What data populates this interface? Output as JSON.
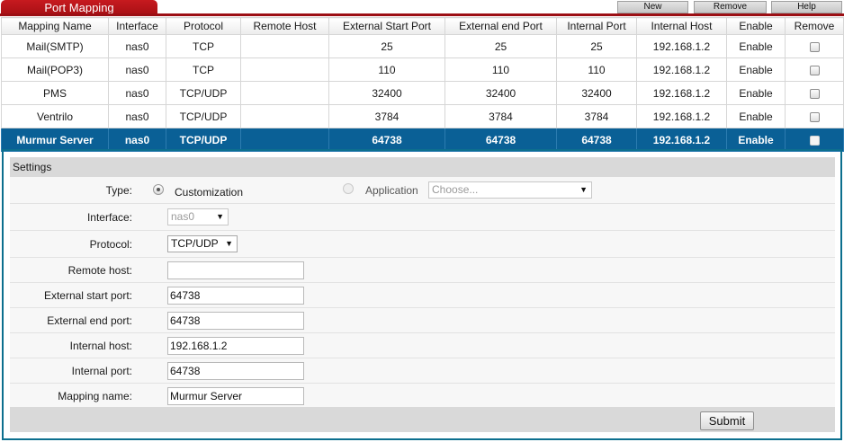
{
  "header": {
    "title": "Port Mapping",
    "buttons": {
      "new": "New",
      "remove": "Remove",
      "help": "Help"
    }
  },
  "table": {
    "columns": [
      "Mapping Name",
      "Interface",
      "Protocol",
      "Remote Host",
      "External Start Port",
      "External end Port",
      "Internal Port",
      "Internal Host",
      "Enable",
      "Remove"
    ],
    "rows": [
      {
        "name": "Mail(SMTP)",
        "interface": "nas0",
        "protocol": "TCP",
        "remote_host": "",
        "ext_start": "25",
        "ext_end": "25",
        "int_port": "25",
        "int_host": "192.168.1.2",
        "enable": "Enable",
        "remove_checked": false
      },
      {
        "name": "Mail(POP3)",
        "interface": "nas0",
        "protocol": "TCP",
        "remote_host": "",
        "ext_start": "110",
        "ext_end": "110",
        "int_port": "110",
        "int_host": "192.168.1.2",
        "enable": "Enable",
        "remove_checked": false
      },
      {
        "name": "PMS",
        "interface": "nas0",
        "protocol": "TCP/UDP",
        "remote_host": "",
        "ext_start": "32400",
        "ext_end": "32400",
        "int_port": "32400",
        "int_host": "192.168.1.2",
        "enable": "Enable",
        "remove_checked": false
      },
      {
        "name": "Ventrilo",
        "interface": "nas0",
        "protocol": "TCP/UDP",
        "remote_host": "",
        "ext_start": "3784",
        "ext_end": "3784",
        "int_port": "3784",
        "int_host": "192.168.1.2",
        "enable": "Enable",
        "remove_checked": false
      },
      {
        "name": "Murmur Server",
        "interface": "nas0",
        "protocol": "TCP/UDP",
        "remote_host": "",
        "ext_start": "64738",
        "ext_end": "64738",
        "int_port": "64738",
        "int_host": "192.168.1.2",
        "enable": "Enable",
        "remove_checked": false
      }
    ],
    "selected_row": 4
  },
  "settings": {
    "title": "Settings",
    "type_label": "Type:",
    "type_options": {
      "customization": "Customization",
      "application": "Application"
    },
    "type_selected": "customization",
    "application_select": "Choose...",
    "interface_label": "Interface:",
    "interface_value": "nas0",
    "protocol_label": "Protocol:",
    "protocol_value": "TCP/UDP",
    "remote_host_label": "Remote host:",
    "remote_host_value": "",
    "ext_start_label": "External start port:",
    "ext_start_value": "64738",
    "ext_end_label": "External end port:",
    "ext_end_value": "64738",
    "int_host_label": "Internal host:",
    "int_host_value": "192.168.1.2",
    "int_port_label": "Internal port:",
    "int_port_value": "64738",
    "mapping_name_label": "Mapping name:",
    "mapping_name_value": "Murmur Server",
    "submit_label": "Submit"
  },
  "colors": {
    "brand_red": "#a50f14",
    "selected_row": "#0a6096",
    "panel_border": "#0c6f8e"
  }
}
